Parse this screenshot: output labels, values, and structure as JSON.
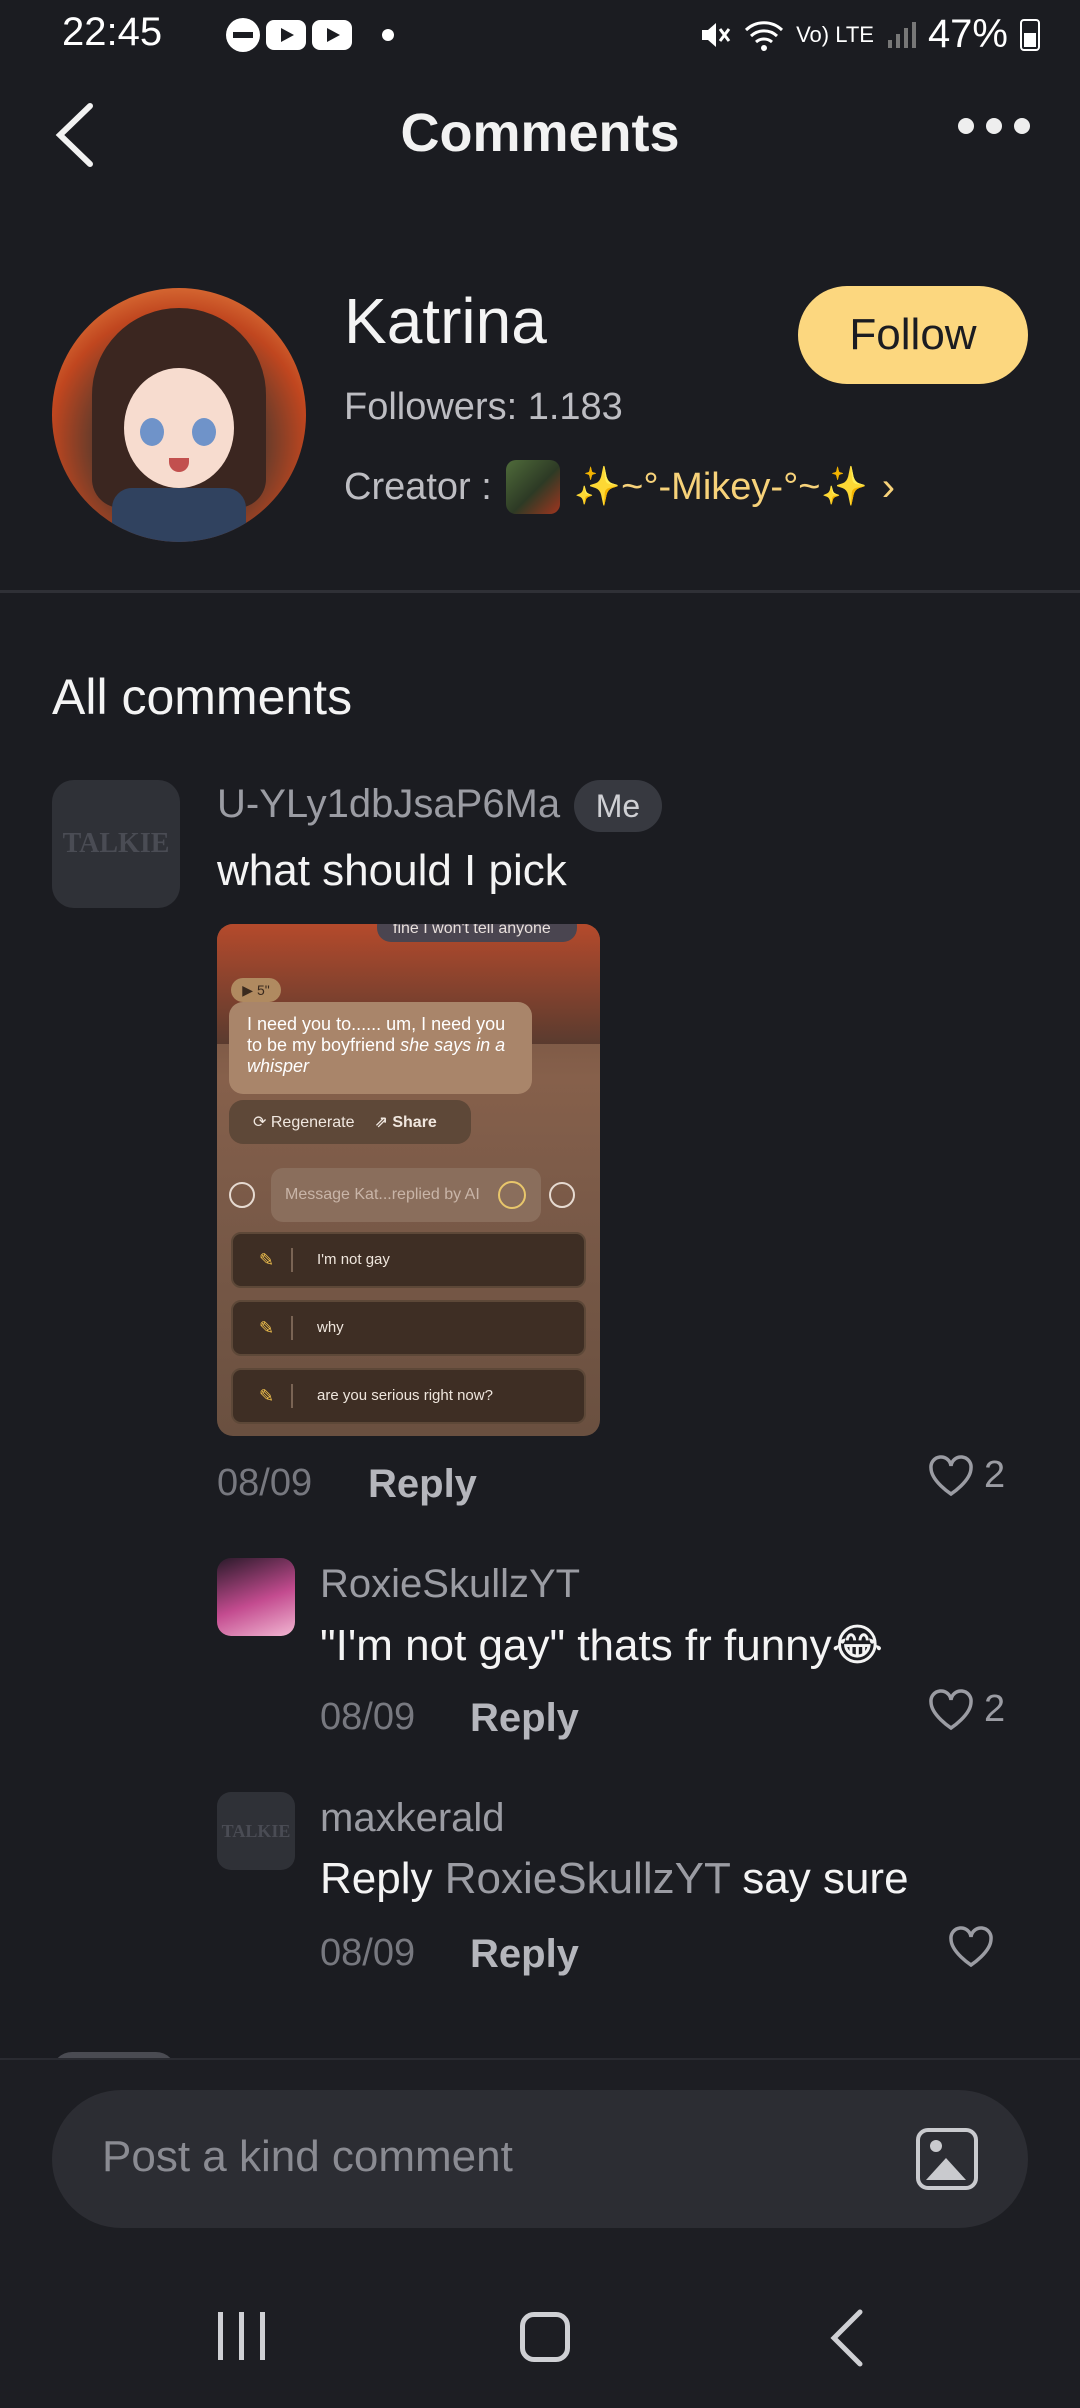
{
  "status_bar": {
    "time": "22:45",
    "battery": "47%",
    "network": "Vo) LTE"
  },
  "header": {
    "title": "Comments"
  },
  "profile": {
    "name": "Katrina",
    "followers": "Followers: 1.183",
    "creator_label": "Creator :",
    "creator_name": "✨~°-Mikey-°~✨",
    "follow_label": "Follow"
  },
  "comments_section": {
    "title": "All comments"
  },
  "comments": [
    {
      "avatar_text": "TALKIE",
      "user": "U-YLy1dbJsaP6Ma",
      "badge": "Me",
      "text": "what should I pick",
      "date": "08/09",
      "reply_label": "Reply",
      "likes": "2",
      "attachment": {
        "top_pill": "fine I won't tell anyone",
        "duration": "▶ 5\"",
        "bubble_text": "I need you to...... um, I need you to be my boyfriend",
        "bubble_italic": "she says in a whisper",
        "regenerate_label": "Regenerate",
        "share_label": "Share",
        "input_placeholder": "Message Kat...replied by AI",
        "choices": [
          "I'm not gay",
          "why",
          "are you serious right now?"
        ]
      }
    },
    {
      "user": "RoxieSkullzYT",
      "text": "\"I'm not gay\" thats fr funny😂",
      "date": "08/09",
      "reply_label": "Reply",
      "likes": "2"
    },
    {
      "avatar_text": "TALKIE",
      "user": "maxkerald",
      "text_prefix": "Reply",
      "text_mention": "RoxieSkullzYT",
      "text_suffix": "say sure",
      "date": "08/09",
      "reply_label": "Reply",
      "likes": ""
    }
  ],
  "composer": {
    "placeholder": "Post a kind comment",
    "image_icon": "image-icon"
  },
  "colors": {
    "background": "#1b1c21",
    "accent": "#fcd77f",
    "creator_name": "#f7d27a"
  }
}
